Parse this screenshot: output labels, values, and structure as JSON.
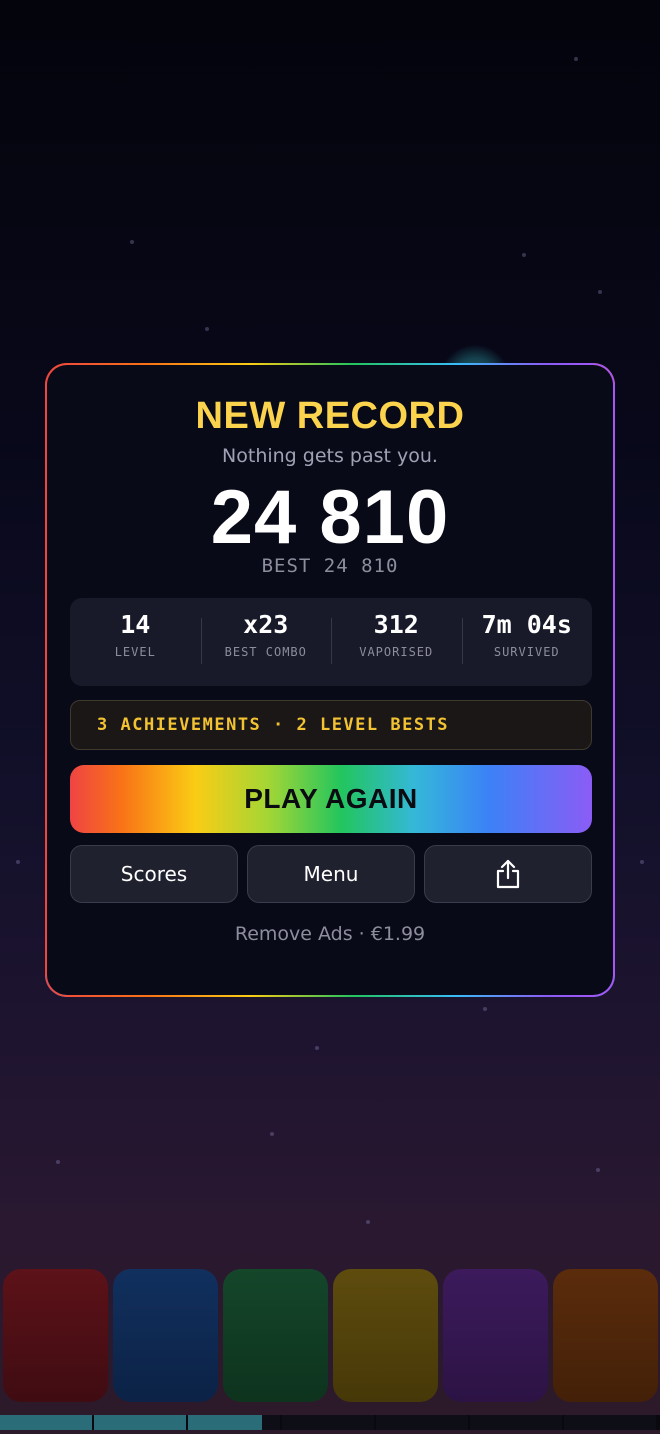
{
  "modal": {
    "title": "NEW RECORD",
    "subtitle": "Nothing gets past you.",
    "score": "24 810",
    "best": "BEST 24 810",
    "stats": [
      {
        "value": "14",
        "label": "LEVEL"
      },
      {
        "value": "x23",
        "label": "BEST COMBO"
      },
      {
        "value": "312",
        "label": "VAPORISED"
      },
      {
        "value": "7m 04s",
        "label": "SURVIVED"
      }
    ],
    "achievements": "3 ACHIEVEMENTS · 2 LEVEL BESTS",
    "play_again": "PLAY AGAIN",
    "scores_button": "Scores",
    "menu_button": "Menu",
    "share_icon": "share-icon",
    "remove_ads": "Remove Ads · €1.99"
  },
  "colors": {
    "title": "#fcd34d",
    "achievements": "#f3c233",
    "tiles": [
      "#5c1218",
      "#11305e",
      "#14462a",
      "#5e4c0e",
      "#3c1a5c",
      "#5b2c0c"
    ],
    "progress_fill": "#2a6d78"
  },
  "progress": {
    "segments_total": 7,
    "segments_filled": 2.8
  }
}
